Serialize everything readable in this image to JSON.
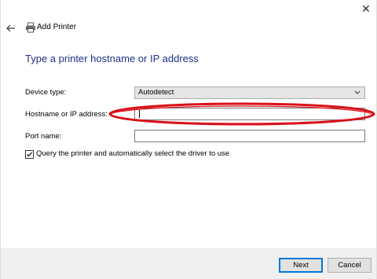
{
  "window": {
    "title": "Add Printer",
    "close_glyph": "✕",
    "back_icon": "back-arrow-icon",
    "title_icon": "printer-icon"
  },
  "heading": "Type a printer hostname or IP address",
  "form": {
    "device_type": {
      "label": "Device type:",
      "selected": "Autodetect"
    },
    "hostname": {
      "label": "Hostname or IP address:",
      "value": ""
    },
    "port_name": {
      "label": "Port name:",
      "value": ""
    },
    "query_checkbox": {
      "label": "Query the printer and automatically select the driver to use",
      "checked": true
    }
  },
  "annotation": {
    "shape": "ellipse",
    "color": "#d9111a",
    "target": "hostname"
  },
  "footer": {
    "next_label": "Next",
    "cancel_label": "Cancel"
  },
  "colors": {
    "heading": "#1e3287",
    "accent": "#0078d7",
    "footer_bg": "#f0f0f0"
  }
}
